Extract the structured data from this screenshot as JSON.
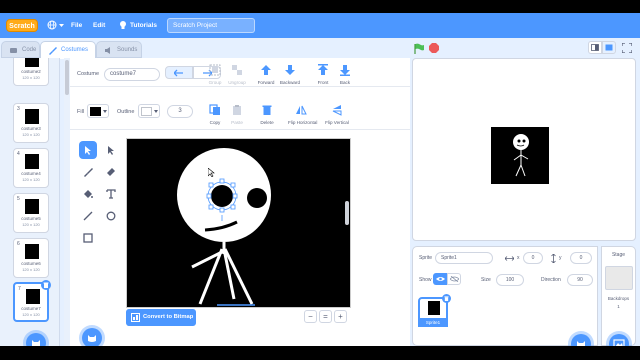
{
  "menubar": {
    "logo": "Scratch",
    "file": "File",
    "edit": "Edit",
    "tutorials": "Tutorials",
    "project_title": "Scratch Project"
  },
  "tabs": [
    {
      "label": "Code",
      "icon": "code-icon"
    },
    {
      "label": "Costumes",
      "icon": "brush-icon"
    },
    {
      "label": "Sounds",
      "icon": "speaker-icon"
    }
  ],
  "costume_list": [
    {
      "num": "",
      "name": "costume2",
      "size": "120 x 120"
    },
    {
      "num": "3",
      "name": "costume3",
      "size": "120 x 120"
    },
    {
      "num": "4",
      "name": "costume4",
      "size": "120 x 120"
    },
    {
      "num": "5",
      "name": "costume5",
      "size": "120 x 120"
    },
    {
      "num": "6",
      "name": "costume6",
      "size": "120 x 120"
    },
    {
      "num": "7",
      "name": "costume7",
      "size": "120 x 120"
    }
  ],
  "editor": {
    "costume_label": "Costume",
    "costume_name": "costume7",
    "fill_label": "Fill",
    "fill_color": "#000000",
    "outline_label": "Outline",
    "outline_width": "3",
    "group": "Group",
    "ungroup": "Ungroup",
    "forward": "Forward",
    "backward": "Backward",
    "front": "Front",
    "back": "Back",
    "copy": "Copy",
    "paste": "Paste",
    "delete": "Delete",
    "flip_h": "Flip Horizontal",
    "flip_v": "Flip Vertical",
    "convert": "Convert to Bitmap",
    "zoom_out": "−",
    "zoom_reset": "=",
    "zoom_in": "+"
  },
  "sprite_info": {
    "sprite_label": "Sprite",
    "sprite_name": "Sprite1",
    "x_label": "x",
    "x_value": "0",
    "y_label": "y",
    "y_value": "0",
    "show_label": "Show",
    "size_label": "Size",
    "size_value": "100",
    "direction_label": "Direction",
    "direction_value": "90",
    "sprite_tile": "Sprite1"
  },
  "stage_panel": {
    "label": "Stage",
    "backdrops_label": "Backdrops",
    "backdrops_count": "1"
  },
  "colors": {
    "accent": "#4c97ff",
    "green_flag": "#4cbf56",
    "stop": "#ec5959"
  }
}
